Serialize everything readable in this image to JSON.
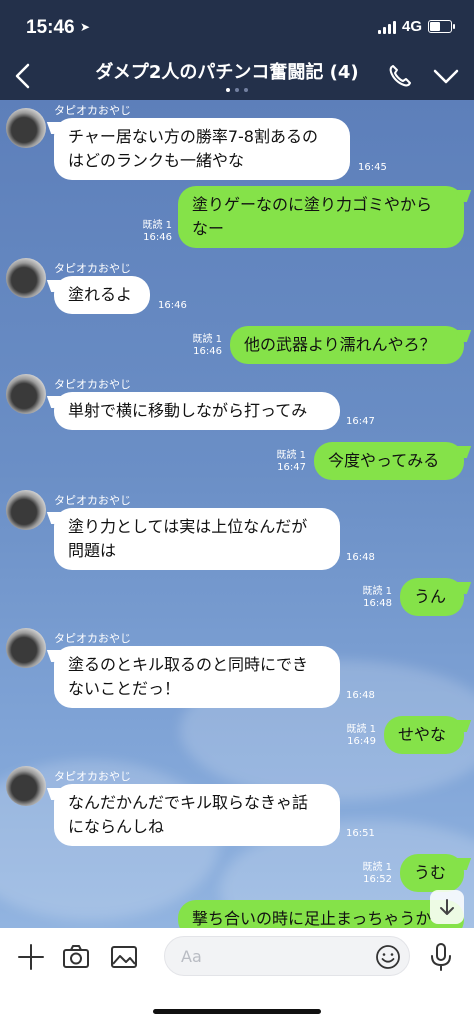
{
  "status_bar": {
    "time": "15:46",
    "network": "4G",
    "battery_level": 0.6
  },
  "header": {
    "title": "ダメプ2人のパチンコ奮闘記 (4)"
  },
  "messages": [
    {
      "dir": "in",
      "sender": "タピオカおやじ",
      "text": "チャー居ない方の勝率7-8割あるの\nはどのランクも一緒やな",
      "time": "16:45"
    },
    {
      "dir": "out",
      "read": "既読 1",
      "text": "塗りゲーなのに塗り力ゴミやから\nなー",
      "time": "16:46"
    },
    {
      "dir": "in",
      "sender": "タピオカおやじ",
      "text": "塗れるよ",
      "time": "16:46"
    },
    {
      "dir": "out",
      "read": "既読 1",
      "text": "他の武器より濡れんやろ？",
      "time": "16:46"
    },
    {
      "dir": "in",
      "sender": "タピオカおやじ",
      "text": "単射で横に移動しながら打ってみ",
      "time": "16:47"
    },
    {
      "dir": "out",
      "read": "既読 1",
      "text": "今度やってみる",
      "time": "16:47"
    },
    {
      "dir": "in",
      "sender": "タピオカおやじ",
      "text": "塗り力としては実は上位なんだが\n問題は",
      "time": "16:48"
    },
    {
      "dir": "out",
      "read": "既読 1",
      "text": "うん",
      "time": "16:48"
    },
    {
      "dir": "in",
      "sender": "タピオカおやじ",
      "text": "塗るのとキル取るのと同時にでき\nないことだっ！",
      "time": "16:48"
    },
    {
      "dir": "out",
      "read": "既読 1",
      "text": "せやな",
      "time": "16:49"
    },
    {
      "dir": "in",
      "sender": "タピオカおやじ",
      "text": "なんだかんだでキル取らなきゃ話\nにならんしね",
      "time": "16:51"
    },
    {
      "dir": "out",
      "read": "既読 1",
      "text": "うむ",
      "time": "16:52"
    },
    {
      "dir": "out",
      "read": "",
      "text": "撃ち合いの時に足止まっちゃうか",
      "time": ""
    }
  ],
  "input": {
    "placeholder": "Aa"
  },
  "icons": {
    "back": "chevron-left-icon",
    "call": "phone-icon",
    "menu": "chevron-down-icon",
    "scroll": "arrow-down-icon",
    "add": "plus-icon",
    "camera": "camera-icon",
    "image": "image-icon",
    "emoji": "emoji-icon",
    "mic": "mic-icon"
  },
  "colors": {
    "header": "#23304a",
    "outgoing_bubble": "#85e249",
    "incoming_bubble": "#ffffff"
  }
}
